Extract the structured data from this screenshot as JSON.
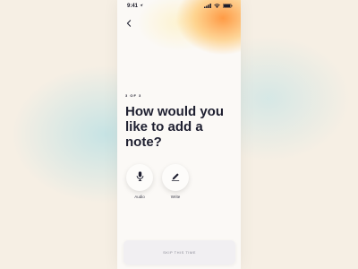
{
  "status_bar": {
    "time": "9:41",
    "location_icon": "location-arrow-icon",
    "signal_icon": "signal-bars-icon",
    "wifi_icon": "wifi-icon",
    "battery_icon": "battery-icon"
  },
  "nav": {
    "back_icon": "chevron-left-icon"
  },
  "step_indicator": "3 OF 3",
  "title": "How would you like to add a note?",
  "options": [
    {
      "label": "Audio",
      "icon": "microphone-icon"
    },
    {
      "label": "Write",
      "icon": "pencil-icon"
    }
  ],
  "skip_button": "SKIP THIS TIME",
  "colors": {
    "accent_orange": "#ff9a3c",
    "title_text": "#1e1f30",
    "screen_background": "#fbf9f6"
  }
}
